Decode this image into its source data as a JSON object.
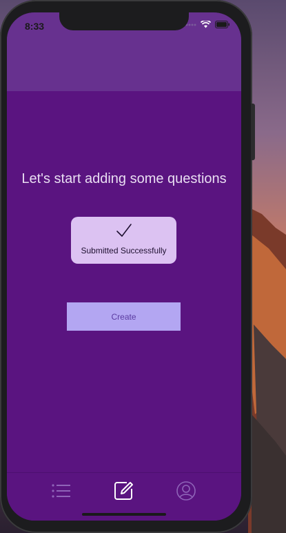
{
  "status_bar": {
    "time": "8:33"
  },
  "main": {
    "headline": "Let's start adding some questions",
    "toast": {
      "icon": "checkmark-icon",
      "message": "Submitted Successfully"
    },
    "create_button": {
      "label": "Create"
    }
  },
  "tab_bar": {
    "tabs": [
      {
        "icon": "list-icon",
        "active": false
      },
      {
        "icon": "edit-icon",
        "active": true
      },
      {
        "icon": "profile-icon",
        "active": false
      }
    ]
  },
  "colors": {
    "header": "#67318f",
    "background": "#5a1480",
    "toast": "#dcc2f2",
    "button": "#b3a6f2",
    "active_tab": "#ffffff",
    "inactive_tab": "#8f64b8"
  }
}
